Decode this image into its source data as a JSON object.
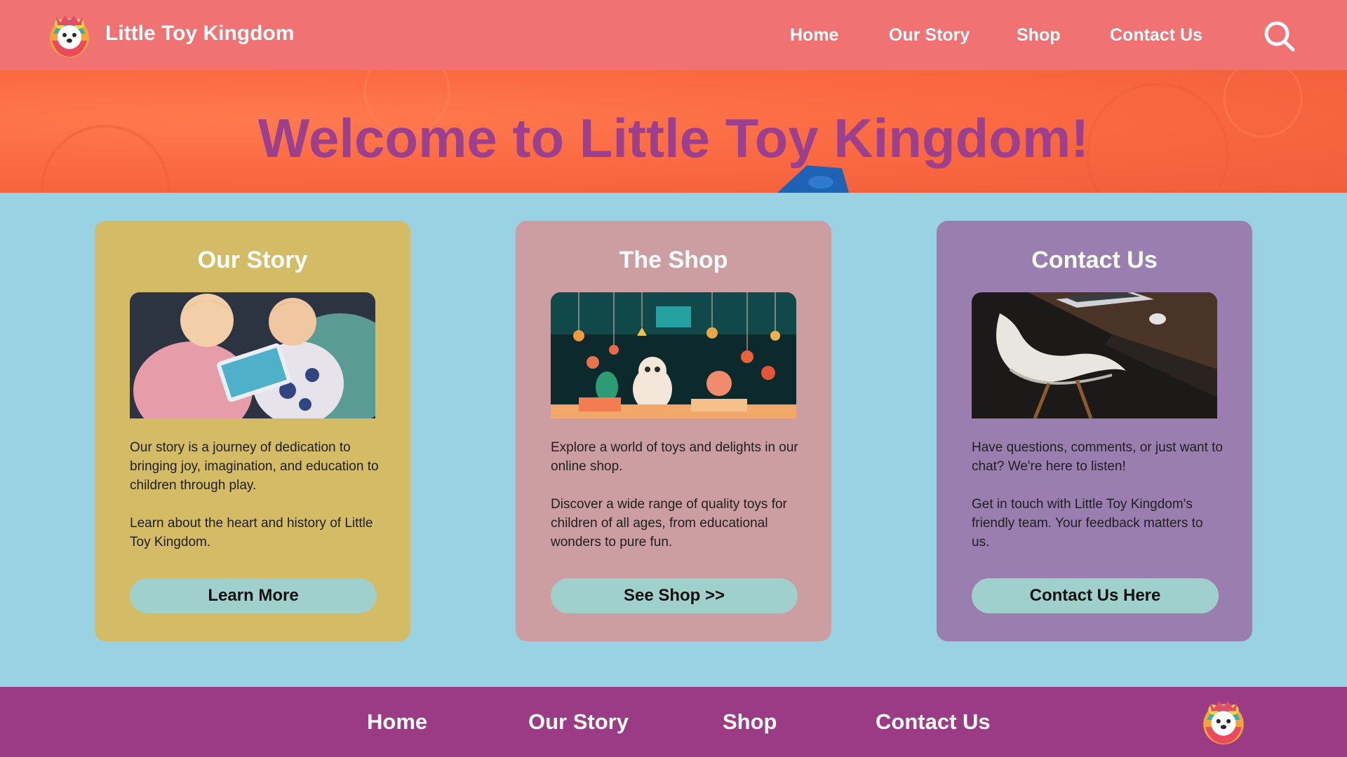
{
  "header": {
    "brand": "Little Toy Kingdom",
    "logo_icon": "bear-mascot-icon",
    "nav": [
      "Home",
      "Our Story",
      "Shop",
      "Contact Us"
    ],
    "search_icon": "search-icon"
  },
  "hero": {
    "title": "Welcome to Little Toy Kingdom!"
  },
  "cards": [
    {
      "title": "Our Story",
      "image": "children-with-tablet-photo",
      "paragraphs": [
        "Our story is a journey of dedication to bringing joy, imagination, and education to children through play.",
        "Learn about the heart and history of Little Toy Kingdom."
      ],
      "button": "Learn More",
      "color": "#d4bb65"
    },
    {
      "title": "The Shop",
      "image": "toy-shop-window-photo",
      "paragraphs": [
        "Explore a world of toys and delights in our online shop.",
        "Discover a wide range of quality toys for children of all ages, from educational wonders to pure fun."
      ],
      "button": "See Shop >>",
      "color": "#cd9ea1"
    },
    {
      "title": "Contact Us",
      "image": "desk-chair-laptop-photo",
      "paragraphs": [
        "Have questions, comments, or just want to chat? We're here to listen!",
        "Get in touch with Little Toy Kingdom's friendly team. Your feedback matters to us."
      ],
      "button": "Contact Us Here",
      "color": "#9b7eb0"
    }
  ],
  "footer": {
    "nav": [
      "Home",
      "Our Story",
      "Shop",
      "Contact Us"
    ],
    "logo_icon": "bear-mascot-icon"
  },
  "colors": {
    "header_bg": "#f07272",
    "hero_bg": "#fb6a42",
    "hero_title": "#9b3f8f",
    "content_bg": "#98d2e3",
    "button_bg": "#9fd0cc",
    "footer_bg": "#9b3b86"
  }
}
